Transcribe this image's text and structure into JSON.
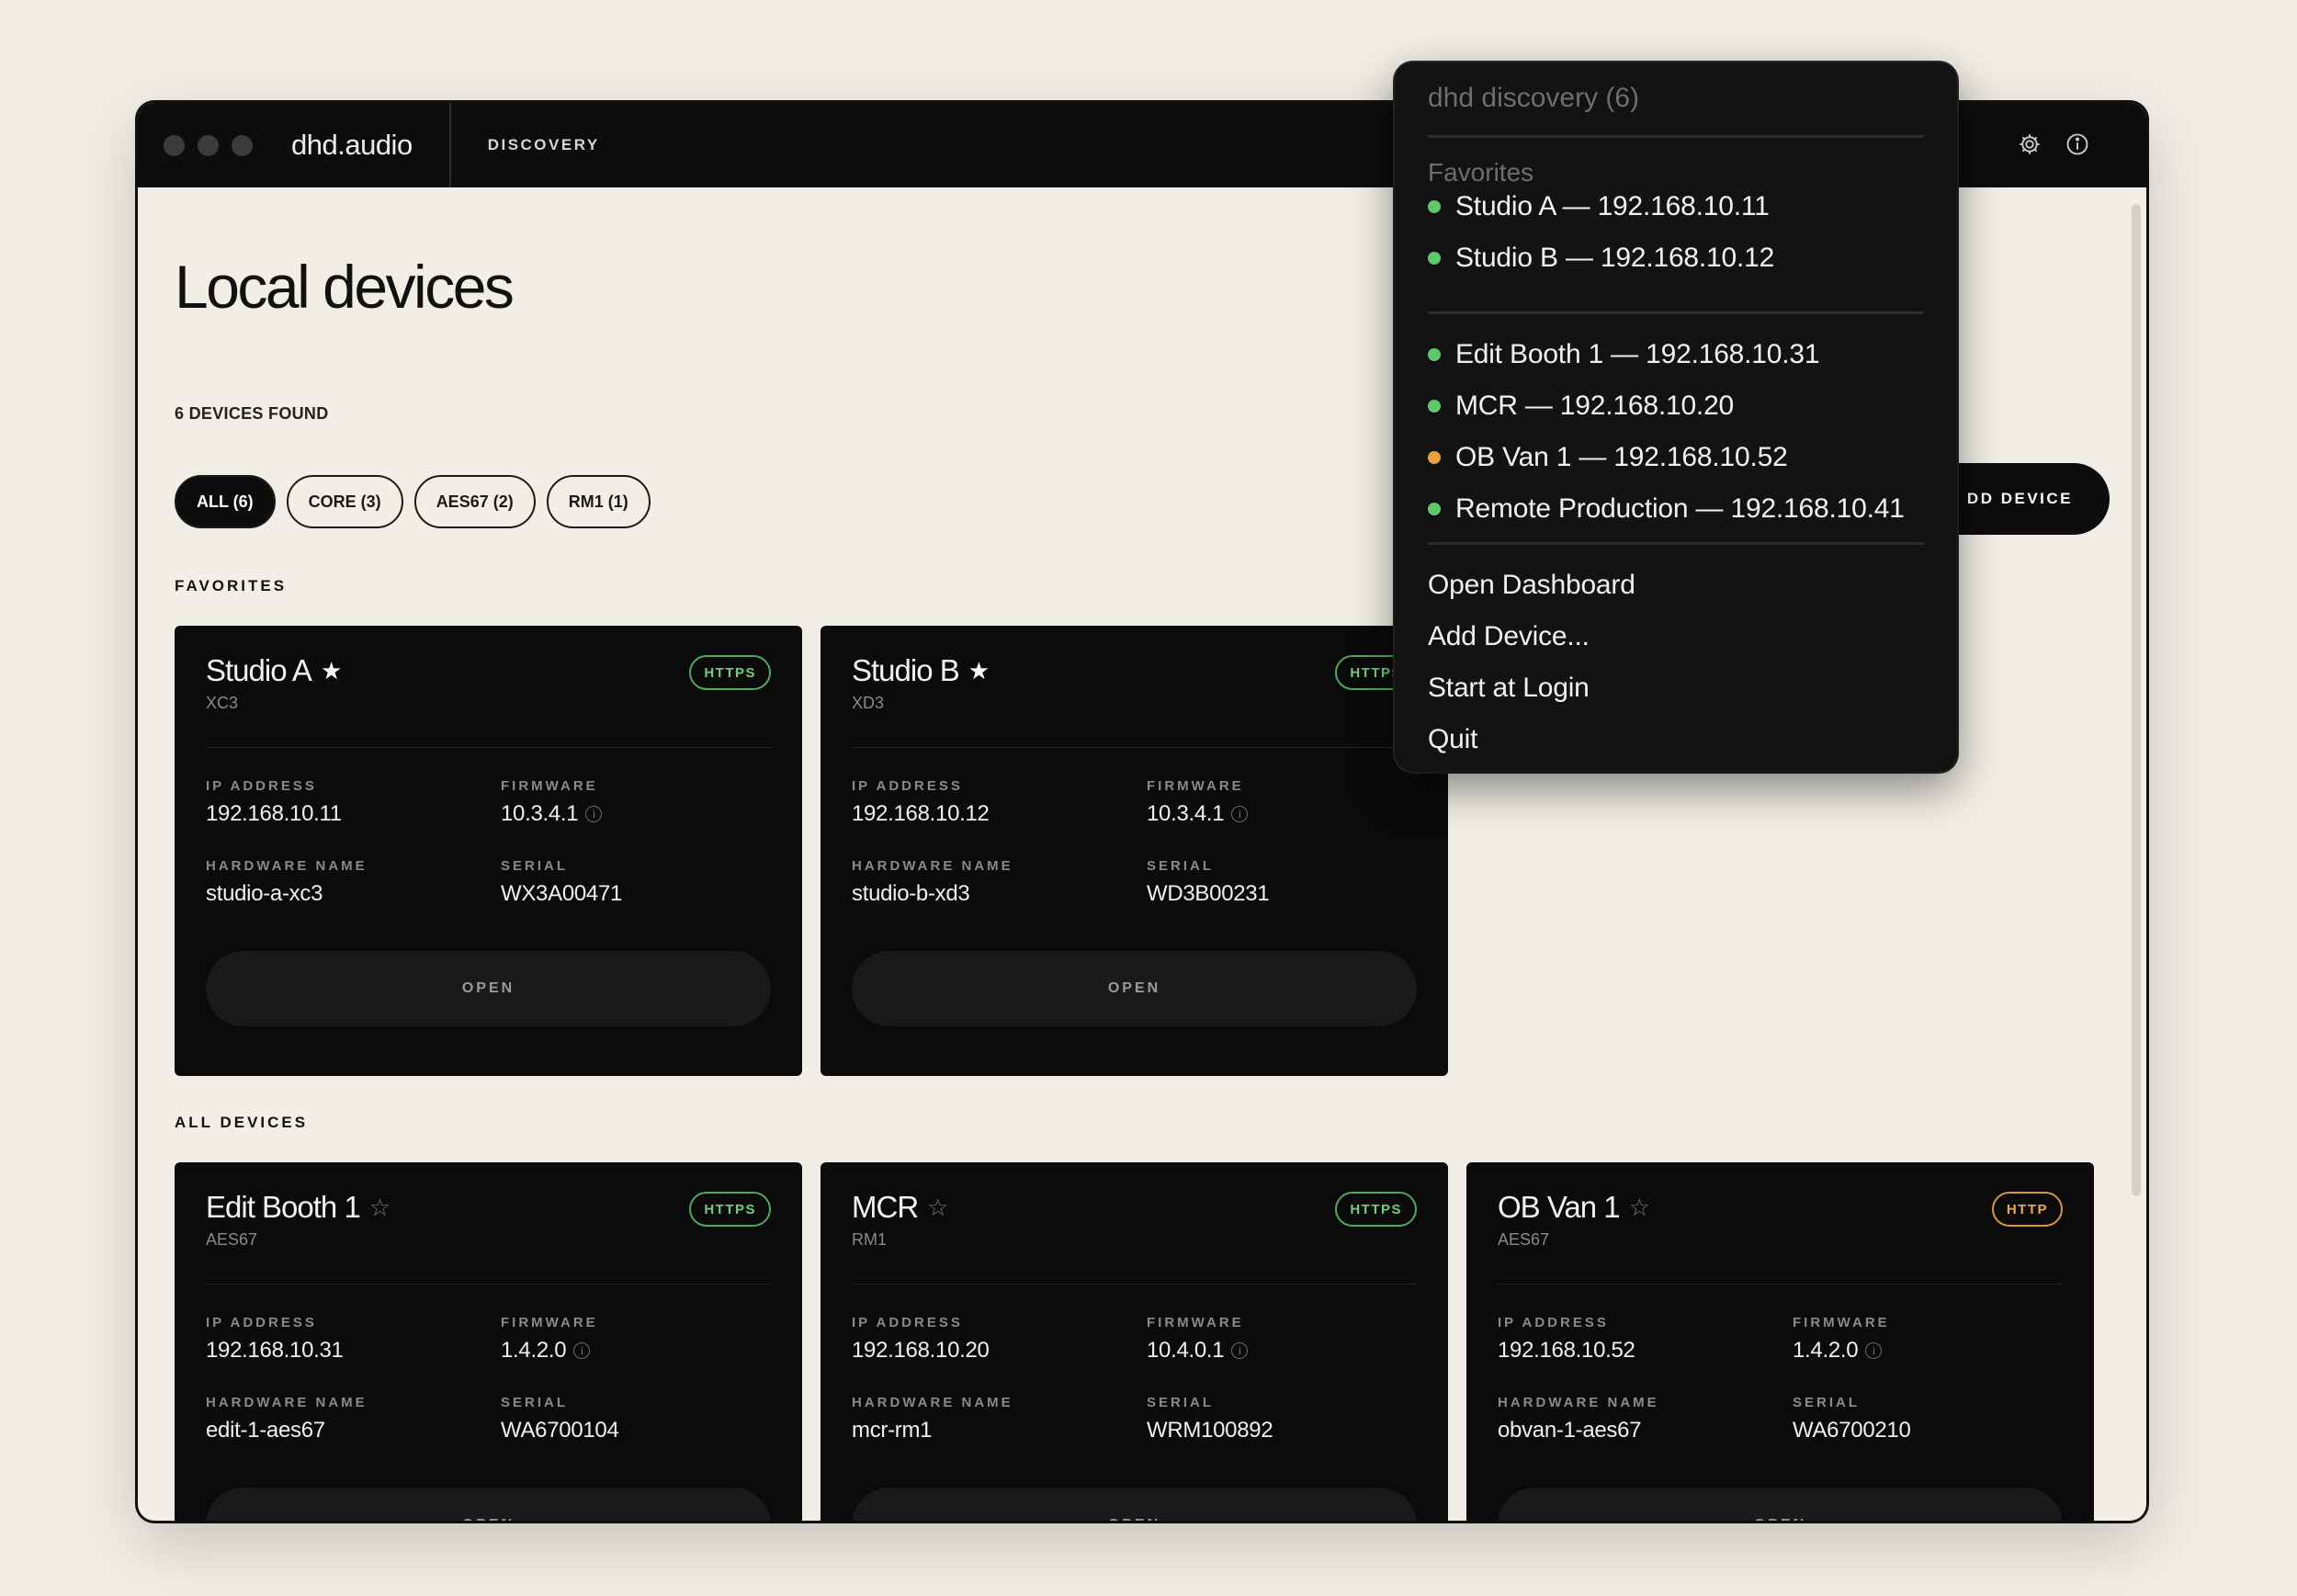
{
  "window": {
    "brand": "dhd.audio",
    "nav_tab": "DISCOVERY"
  },
  "page": {
    "title": "Local devices",
    "subtitle": "6 DEVICES FOUND",
    "add_device_label": "DD DEVICE",
    "filters": [
      {
        "label": "ALL (6)",
        "active": true
      },
      {
        "label": "CORE (3)",
        "active": false
      },
      {
        "label": "AES67 (2)",
        "active": false
      },
      {
        "label": "RM1 (1)",
        "active": false
      }
    ],
    "favorites_label": "FAVORITES",
    "all_devices_label": "ALL DEVICES"
  },
  "card_labels": {
    "ip": "IP ADDRESS",
    "firmware": "FIRMWARE",
    "hardware": "HARDWARE NAME",
    "serial": "SERIAL",
    "open": "OPEN"
  },
  "favorites": [
    {
      "name": "Studio A",
      "model": "XC3",
      "protocol": "HTTPS",
      "ip": "192.168.10.11",
      "firmware": "10.3.4.1",
      "hardware": "studio-a-xc3",
      "serial": "WX3A00471",
      "favorite": true
    },
    {
      "name": "Studio B",
      "model": "XD3",
      "protocol": "HTTPS",
      "ip": "192.168.10.12",
      "firmware": "10.3.4.1",
      "hardware": "studio-b-xd3",
      "serial": "WD3B00231",
      "favorite": true
    }
  ],
  "devices": [
    {
      "name": "Edit Booth 1",
      "model": "AES67",
      "protocol": "HTTPS",
      "ip": "192.168.10.31",
      "firmware": "1.4.2.0",
      "hardware": "edit-1-aes67",
      "serial": "WA6700104",
      "favorite": false
    },
    {
      "name": "MCR",
      "model": "RM1",
      "protocol": "HTTPS",
      "ip": "192.168.10.20",
      "firmware": "10.4.0.1",
      "hardware": "mcr-rm1",
      "serial": "WRM100892",
      "favorite": false
    },
    {
      "name": "OB Van 1",
      "model": "AES67",
      "protocol": "HTTP",
      "ip": "192.168.10.52",
      "firmware": "1.4.2.0",
      "hardware": "obvan-1-aes67",
      "serial": "WA6700210",
      "favorite": false
    }
  ],
  "menu": {
    "title": "dhd discovery (6)",
    "favorites_label": "Favorites",
    "favorite_items": [
      {
        "label": "Studio A — 192.168.10.11",
        "status": "green"
      },
      {
        "label": "Studio B — 192.168.10.12",
        "status": "green"
      }
    ],
    "device_items": [
      {
        "label": "Edit Booth 1 — 192.168.10.31",
        "status": "green"
      },
      {
        "label": "MCR — 192.168.10.20",
        "status": "green"
      },
      {
        "label": "OB Van 1 — 192.168.10.52",
        "status": "amber"
      },
      {
        "label": "Remote Production — 192.168.10.41",
        "status": "green"
      }
    ],
    "actions": [
      "Open Dashboard",
      "Add Device...",
      "Start at Login",
      "Quit"
    ]
  },
  "colors": {
    "https": "#6dd07a",
    "http": "#f0aa4a",
    "status_green": "#5ec86d",
    "status_amber": "#e9a23d"
  },
  "icons": {
    "settings": "gear-icon",
    "info": "info-icon",
    "favorite_on": "★",
    "favorite_off": "☆",
    "info_glyph": "i"
  }
}
